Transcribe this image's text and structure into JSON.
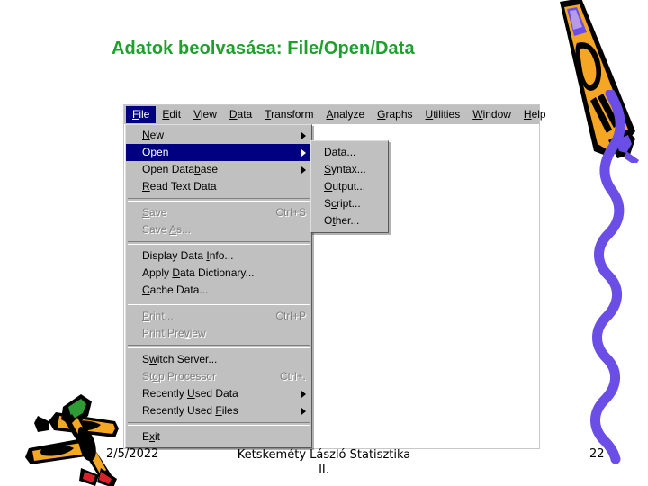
{
  "slide": {
    "title": "Adatok beolvasása: File/Open/Data",
    "title_color": "#1FA02E"
  },
  "app": {
    "menubar": {
      "items": [
        {
          "label": "File",
          "accel": "F",
          "active": true
        },
        {
          "label": "Edit",
          "accel": "E",
          "active": false
        },
        {
          "label": "View",
          "accel": "V",
          "active": false
        },
        {
          "label": "Data",
          "accel": "D",
          "active": false
        },
        {
          "label": "Transform",
          "accel": "T",
          "active": false
        },
        {
          "label": "Analyze",
          "accel": "A",
          "active": false
        },
        {
          "label": "Graphs",
          "accel": "G",
          "active": false
        },
        {
          "label": "Utilities",
          "accel": "U",
          "active": false
        },
        {
          "label": "Window",
          "accel": "W",
          "active": false
        },
        {
          "label": "Help",
          "accel": "H",
          "active": false
        }
      ],
      "highlight_color": "#000080",
      "bar_color": "#C0C0C0"
    },
    "file_menu": {
      "items": [
        {
          "label": "New",
          "accel": "N",
          "shortcut": "",
          "submenu": true,
          "disabled": false,
          "selected": false
        },
        {
          "label": "Open",
          "accel": "O",
          "shortcut": "",
          "submenu": true,
          "disabled": false,
          "selected": true
        },
        {
          "label": "Open Database",
          "accel": "b",
          "shortcut": "",
          "submenu": true,
          "disabled": false,
          "selected": false
        },
        {
          "label": "Read Text Data",
          "accel": "R",
          "shortcut": "",
          "submenu": false,
          "disabled": false,
          "selected": false
        },
        {
          "separator": true
        },
        {
          "label": "Save",
          "accel": "S",
          "shortcut": "Ctrl+S",
          "submenu": false,
          "disabled": true,
          "selected": false
        },
        {
          "label": "Save As...",
          "accel": "A",
          "shortcut": "",
          "submenu": false,
          "disabled": true,
          "selected": false
        },
        {
          "separator": true
        },
        {
          "label": "Display Data Info...",
          "accel": "I",
          "shortcut": "",
          "submenu": false,
          "disabled": false,
          "selected": false
        },
        {
          "label": "Apply Data Dictionary...",
          "accel": "D",
          "shortcut": "",
          "submenu": false,
          "disabled": false,
          "selected": false
        },
        {
          "label": "Cache Data...",
          "accel": "C",
          "shortcut": "",
          "submenu": false,
          "disabled": false,
          "selected": false
        },
        {
          "separator": true
        },
        {
          "label": "Print...",
          "accel": "P",
          "shortcut": "Ctrl+P",
          "submenu": false,
          "disabled": true,
          "selected": false
        },
        {
          "label": "Print Preview",
          "accel": "v",
          "shortcut": "",
          "submenu": false,
          "disabled": true,
          "selected": false
        },
        {
          "separator": true
        },
        {
          "label": "Switch Server...",
          "accel": "w",
          "shortcut": "",
          "submenu": false,
          "disabled": false,
          "selected": false
        },
        {
          "label": "Stop Processor",
          "accel": "o",
          "shortcut": "Ctrl+.",
          "submenu": false,
          "disabled": true,
          "selected": false
        },
        {
          "label": "Recently Used Data",
          "accel": "U",
          "shortcut": "",
          "submenu": true,
          "disabled": false,
          "selected": false
        },
        {
          "label": "Recently Used Files",
          "accel": "F",
          "shortcut": "",
          "submenu": true,
          "disabled": false,
          "selected": false
        },
        {
          "separator": true
        },
        {
          "label": "Exit",
          "accel": "x",
          "shortcut": "",
          "submenu": false,
          "disabled": false,
          "selected": false
        }
      ]
    },
    "open_submenu": {
      "items": [
        {
          "label": "Data...",
          "accel": "D"
        },
        {
          "label": "Syntax...",
          "accel": "S"
        },
        {
          "label": "Output...",
          "accel": "O"
        },
        {
          "label": "Script...",
          "accel": "c"
        },
        {
          "label": "Other...",
          "accel": "t"
        }
      ]
    }
  },
  "footer": {
    "date": "2/5/2022",
    "center": "Ketskeméty László Statisztika II.",
    "page_number": "22"
  },
  "decorations": {
    "crayon_top_right": "crayon-icon",
    "squiggle_right": "squiggle-line-icon",
    "crayons_bottom_left": "crossed-crayons-icon",
    "crayon_body_color": "#F5A623",
    "crayon_tip_color": "#6B4EE6",
    "squiggle_color": "#6B4EE6"
  }
}
